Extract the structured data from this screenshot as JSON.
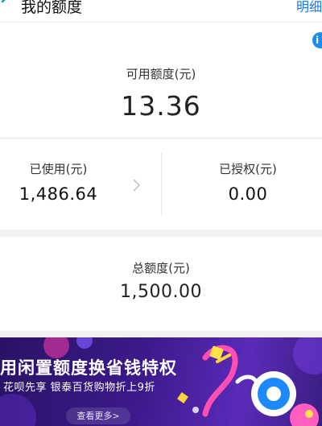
{
  "header": {
    "title": "我的额度",
    "detail_link": "明细"
  },
  "available": {
    "label": "可用额度(元)",
    "value": "13.36"
  },
  "used": {
    "label": "已使用(元)",
    "value": "1,486.64"
  },
  "authorized": {
    "label": "已授权(元)",
    "value": "0.00"
  },
  "total": {
    "label": "总额度(元)",
    "value": "1,500.00"
  },
  "promo": {
    "title": "用闲置额度换省钱特权",
    "subtitle": "花呗先享 银泰百货购物折上9折",
    "more": "查看更多>"
  },
  "colors": {
    "link": "#1677ff",
    "badge": "#1b8cf0",
    "banner": "#3d1a8c"
  },
  "icons": {
    "back": "back-arrow-icon",
    "chevron": "chevron-right-icon",
    "badge": "info-badge-icon"
  }
}
